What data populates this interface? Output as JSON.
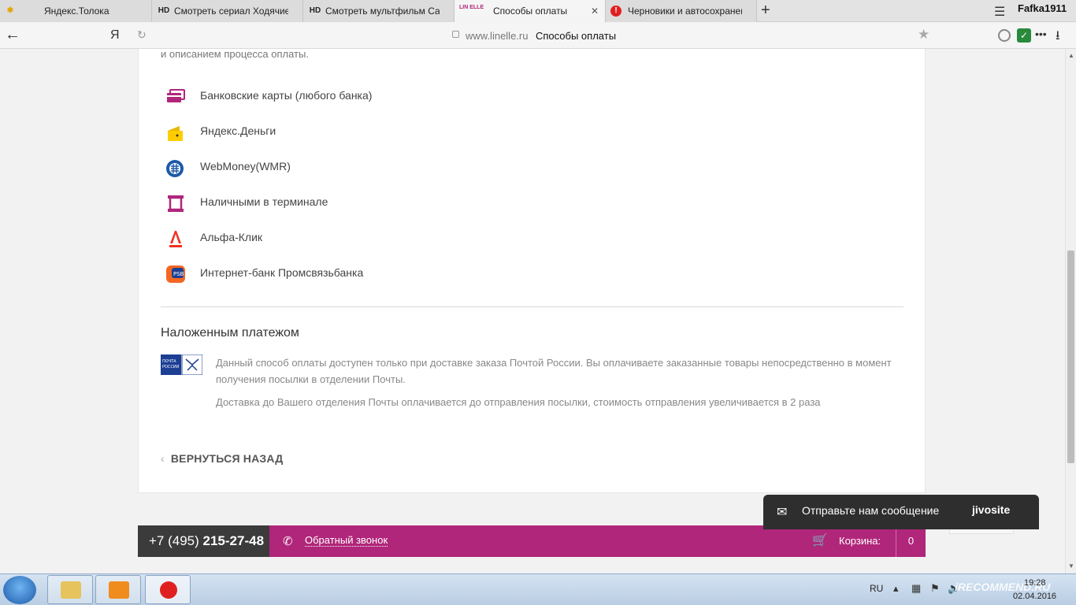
{
  "browser": {
    "tabs": [
      {
        "favicon": "",
        "title": "Яндекс.Толока",
        "active": false
      },
      {
        "favicon": "HD",
        "title": "Смотреть сериал Ходячие м",
        "active": false
      },
      {
        "favicon": "HD",
        "title": "Смотреть мультфильм Само",
        "active": false
      },
      {
        "favicon": "LIN ELLE",
        "title": "Способы оплаты",
        "active": true
      },
      {
        "favicon": "",
        "title": "Черновики и автосохранени",
        "active": false
      }
    ],
    "new_tab": "+",
    "user": "Fafka1911",
    "address": {
      "host": "www.linelle.ru",
      "title": "Способы оплаты"
    },
    "yandex_button": "Я"
  },
  "content": {
    "intro_text": "и описанием процесса оплаты.",
    "payment_methods": [
      {
        "label": "Банковские карты (любого банка)",
        "icon": "bank-card-icon",
        "color": "#b0267a"
      },
      {
        "label": "Яндекс.Деньги",
        "icon": "yandex-money-icon",
        "color": "#ffcc00"
      },
      {
        "label": "WebMoney(WMR)",
        "icon": "webmoney-icon",
        "color": "#1c5aa8"
      },
      {
        "label": "Наличными в терминале",
        "icon": "terminal-icon",
        "color": "#b0267a"
      },
      {
        "label": "Альфа-Клик",
        "icon": "alfa-bank-icon",
        "color": "#ef3124"
      },
      {
        "label": "Интернет-банк Промсвязьбанка",
        "icon": "psb-icon",
        "color": "#f26722"
      }
    ],
    "cod": {
      "title": "Наложенным платежом",
      "logo_text": "ПОЧТА РОССИИ",
      "text1": "Данный способ оплаты доступен только при доставке заказа Почтой России. Вы оплачиваете заказанные товары непосредственно в момент получения посылки в отделении Почты.",
      "text2": "Доставка до Вашего отделения Почты оплачивается до отправления посылки, стоимость отправления увеличивается в 2 раза"
    },
    "back_link": "ВЕРНУТЬСЯ НАЗАД"
  },
  "footer": {
    "phone_prefix": "+7 (495) ",
    "phone_number": "215-27-48",
    "callback": "Обратный звонок",
    "cart_label": "Корзина:",
    "cart_count": "0"
  },
  "jivo": {
    "text": "Отправьте нам сообщение",
    "brand": "jivosite"
  },
  "taskbar": {
    "lang": "RU",
    "time": "19:28",
    "date": "02.04.2016",
    "watermark": "iRECOMMEND.RU"
  }
}
